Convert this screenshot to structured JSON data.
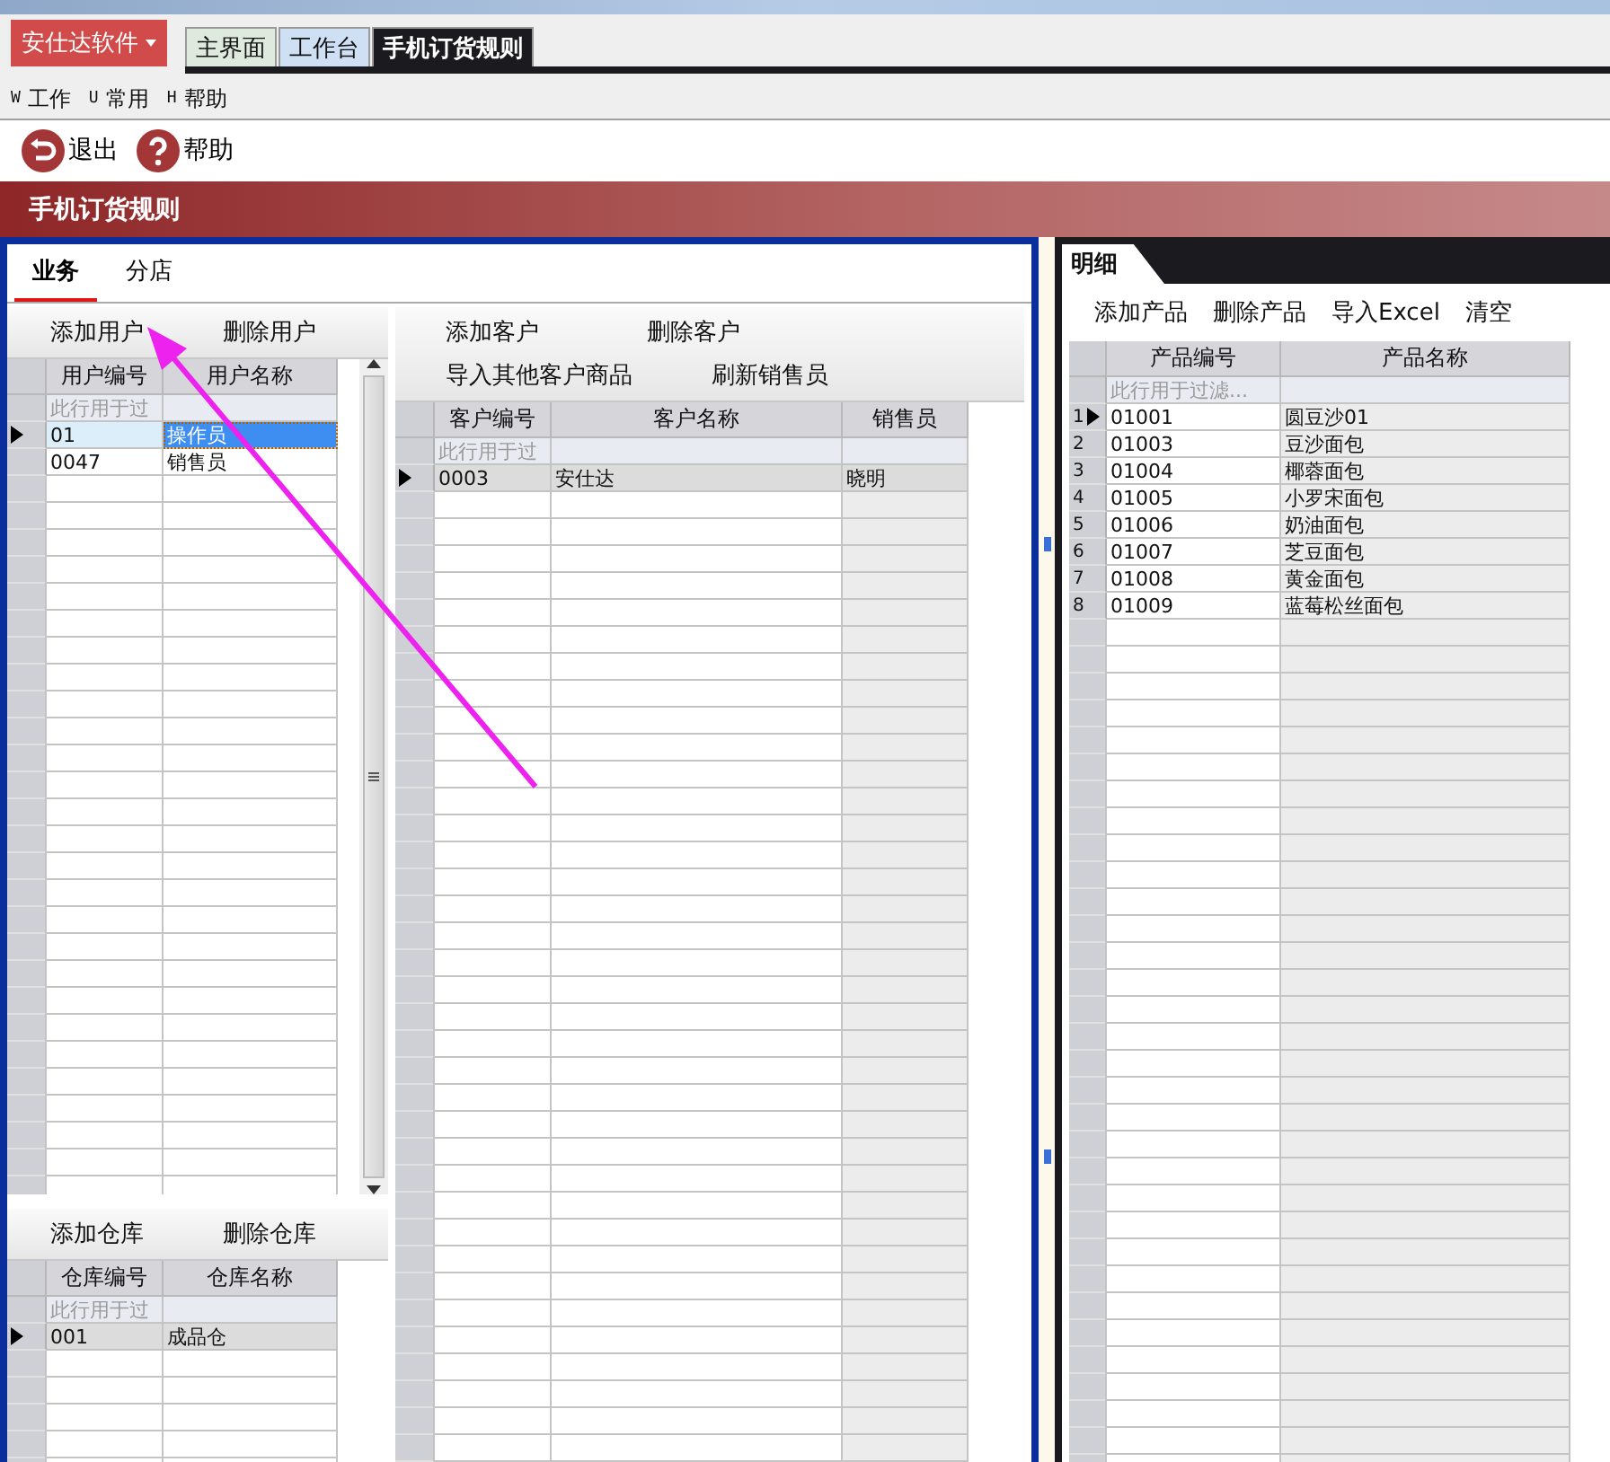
{
  "app_menu": {
    "label": "安仕达软件"
  },
  "doc_tabs": [
    {
      "label": "主界面",
      "selected": false
    },
    {
      "label": "工作台",
      "selected": false
    },
    {
      "label": "手机订货规则",
      "selected": true
    }
  ],
  "menu": [
    {
      "key": "W",
      "label": "工作"
    },
    {
      "key": "U",
      "label": "常用"
    },
    {
      "key": "H",
      "label": "帮助"
    }
  ],
  "toolbar": [
    {
      "kind": "exit",
      "label": "退出"
    },
    {
      "kind": "help",
      "label": "帮助"
    }
  ],
  "page_title": "手机订货规则",
  "left_panel": {
    "tabs": [
      {
        "label": "业务",
        "selected": true
      },
      {
        "label": "分店",
        "selected": false
      }
    ],
    "users": {
      "buttons": [
        "添加用户",
        "删除用户"
      ],
      "columns": [
        {
          "label": "用户编号",
          "readonly": false
        },
        {
          "label": "用户名称",
          "readonly": false
        }
      ],
      "filter": "此行用于过",
      "rows": [
        {
          "current": true,
          "cells": [
            {
              "text": "01",
              "selected": false
            },
            {
              "text": "操作员",
              "selected": true
            }
          ]
        },
        {
          "current": false,
          "cells": [
            {
              "text": "0047",
              "selected": false
            },
            {
              "text": "销售员",
              "selected": false
            }
          ]
        }
      ]
    },
    "warehouses": {
      "buttons": [
        "添加仓库",
        "删除仓库"
      ],
      "columns": [
        {
          "label": "仓库编号",
          "readonly": false
        },
        {
          "label": "仓库名称",
          "readonly": false
        }
      ],
      "filter": "此行用于过",
      "rows": [
        {
          "current": true,
          "cells": [
            {
              "text": "001",
              "selected": false
            },
            {
              "text": "成品仓",
              "selected": false
            }
          ]
        }
      ]
    },
    "customers": {
      "button_rows": [
        [
          "添加客户",
          "删除客户"
        ],
        [
          "导入其他客户商品",
          "刷新销售员"
        ]
      ],
      "columns": [
        {
          "label": "客户编号",
          "readonly": false
        },
        {
          "label": "客户名称",
          "readonly": false
        },
        {
          "label": "销售员",
          "readonly": true
        }
      ],
      "filter": "此行用于过",
      "rows": [
        {
          "current": true,
          "cells": [
            {
              "text": "0003",
              "selected": false
            },
            {
              "text": "安仕达",
              "selected": false
            },
            {
              "text": "晓明",
              "selected": false
            }
          ]
        }
      ]
    }
  },
  "detail_panel": {
    "tab": "明细",
    "buttons": [
      "添加产品",
      "删除产品",
      "导入Excel",
      "清空"
    ],
    "columns": [
      {
        "label": "产品编号",
        "readonly": false
      },
      {
        "label": "产品名称",
        "readonly": true
      }
    ],
    "filter": "此行用于过滤...",
    "rows": [
      {
        "number": "1",
        "current": true,
        "cells": [
          {
            "text": "01001",
            "selected": false
          },
          {
            "text": "圆豆沙01",
            "selected": false
          }
        ]
      },
      {
        "number": "2",
        "current": false,
        "cells": [
          {
            "text": "01003",
            "selected": false
          },
          {
            "text": "豆沙面包",
            "selected": false
          }
        ]
      },
      {
        "number": "3",
        "current": false,
        "cells": [
          {
            "text": "01004",
            "selected": false
          },
          {
            "text": "椰蓉面包",
            "selected": false
          }
        ]
      },
      {
        "number": "4",
        "current": false,
        "cells": [
          {
            "text": "01005",
            "selected": false
          },
          {
            "text": "小罗宋面包",
            "selected": false
          }
        ]
      },
      {
        "number": "5",
        "current": false,
        "cells": [
          {
            "text": "01006",
            "selected": false
          },
          {
            "text": "奶油面包",
            "selected": false
          }
        ]
      },
      {
        "number": "6",
        "current": false,
        "cells": [
          {
            "text": "01007",
            "selected": false
          },
          {
            "text": "芝豆面包",
            "selected": false
          }
        ]
      },
      {
        "number": "7",
        "current": false,
        "cells": [
          {
            "text": "01008",
            "selected": false
          },
          {
            "text": "黄金面包",
            "selected": false
          }
        ]
      },
      {
        "number": "8",
        "current": false,
        "cells": [
          {
            "text": "01009",
            "selected": false
          },
          {
            "text": "蓝莓松丝面包",
            "selected": false
          }
        ]
      }
    ]
  }
}
